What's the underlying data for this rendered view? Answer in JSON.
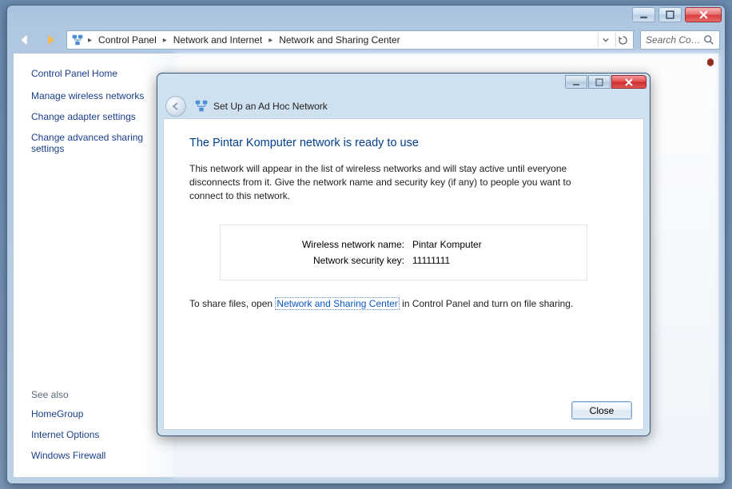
{
  "outer": {
    "breadcrumbs": [
      "Control Panel",
      "Network and Internet",
      "Network and Sharing Center"
    ],
    "search_placeholder": "Search Con..."
  },
  "sidebar": {
    "heading": "Control Panel Home",
    "links": [
      "Manage wireless networks",
      "Change adapter settings",
      "Change advanced sharing settings"
    ],
    "see_also_label": "See also",
    "see_also": [
      "HomeGroup",
      "Internet Options",
      "Windows Firewall"
    ]
  },
  "dialog": {
    "wizard_title": "Set Up an Ad Hoc Network",
    "heading": "The Pintar Komputer network is ready to use",
    "paragraph": "This network will appear in the list of wireless networks and will stay active until everyone disconnects from it. Give the network name and security key (if any) to people you want to connect to this network.",
    "info": {
      "name_label": "Wireless network name:",
      "name_value": "Pintar Komputer",
      "key_label": "Network security key:",
      "key_value": "11111111"
    },
    "share_prefix": "To share files, open ",
    "share_link": "Network and Sharing Center",
    "share_suffix": " in Control Panel and turn on file sharing.",
    "close_label": "Close"
  }
}
